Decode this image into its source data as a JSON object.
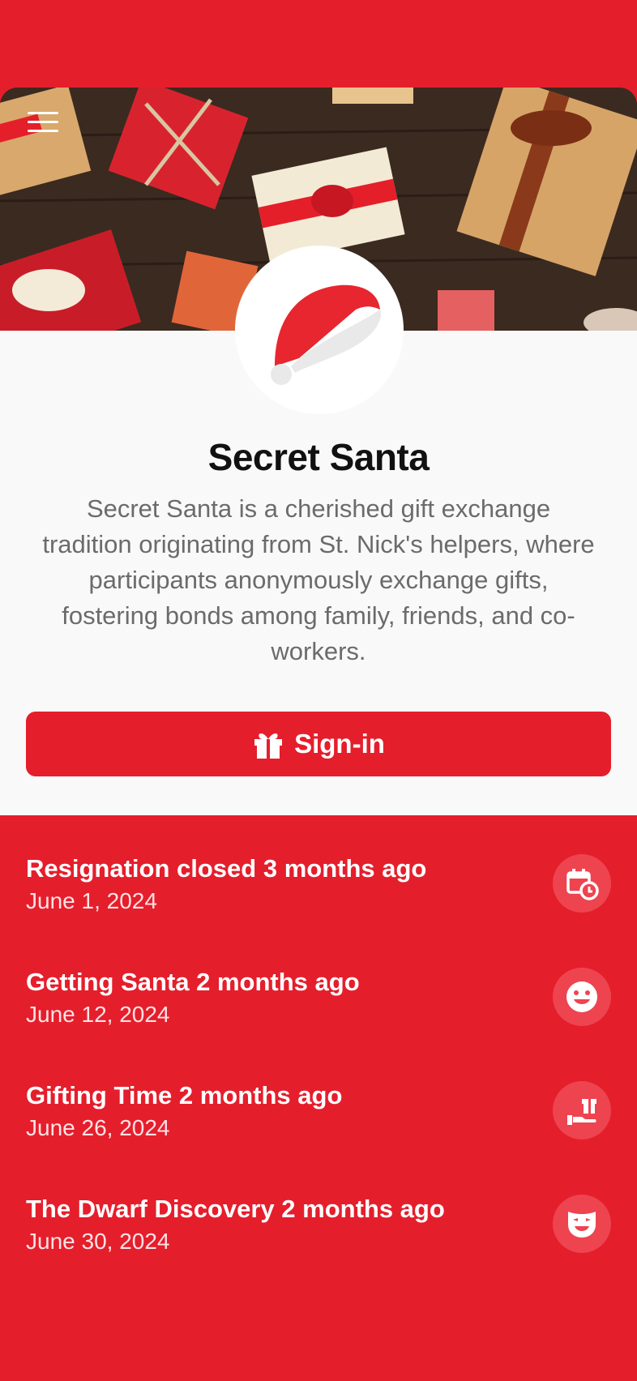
{
  "app": {
    "title": "Secret Santa",
    "description": "Secret Santa is a cherished gift exchange tradition originating from St. Nick's helpers, where participants anonymously exchange gifts, fostering bonds among family, friends, and co-workers."
  },
  "signin": {
    "label": "Sign-in"
  },
  "colors": {
    "brand": "#e51e2c",
    "panel": "#f9f9f9",
    "icon_bg": "#ee4450"
  },
  "events": [
    {
      "title": "Resignation closed 3 months ago",
      "date": "June 1, 2024",
      "icon": "calendar-clock-icon"
    },
    {
      "title": "Getting Santa 2 months ago",
      "date": "June 12, 2024",
      "icon": "smile-icon"
    },
    {
      "title": "Gifting Time 2 months ago",
      "date": "June 26, 2024",
      "icon": "hand-gift-icon"
    },
    {
      "title": "The Dwarf Discovery 2 months ago",
      "date": "June 30, 2024",
      "icon": "mask-icon"
    }
  ]
}
